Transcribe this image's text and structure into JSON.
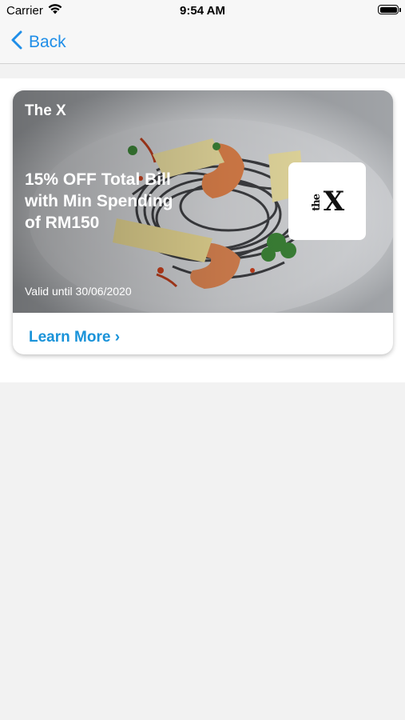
{
  "status_bar": {
    "carrier": "Carrier",
    "time": "9:54 AM",
    "icons": [
      "wifi-icon",
      "battery-icon"
    ]
  },
  "nav": {
    "back_label": "Back",
    "back_icon": "chevron-left-icon",
    "accent_color": "#1f8ee8"
  },
  "card": {
    "brand": "The X",
    "title": "15% OFF Total Bill\nwith Min Spending\nof RM150",
    "valid": "Valid until 30/06/2020",
    "logo_text": "X",
    "logo_small": "the",
    "cta_label": "Learn More ›",
    "cta_color": "#1a93d9",
    "image": "food-photo-squid-ink-pasta-prawns"
  }
}
